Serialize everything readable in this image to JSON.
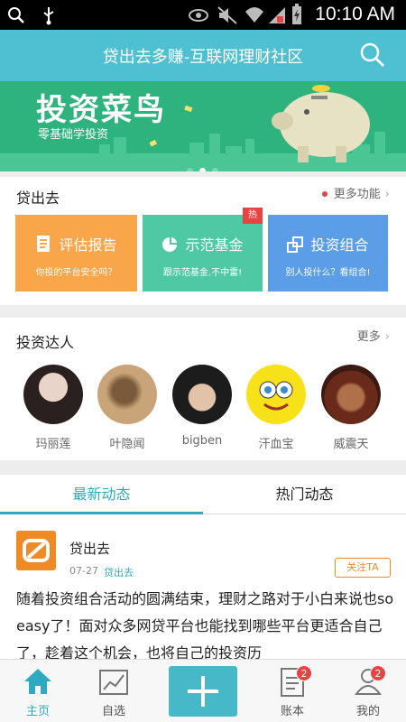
{
  "status_bar": {
    "time": "10:10 AM"
  },
  "header": {
    "title": "贷出去多赚-互联网理财社区"
  },
  "banner": {
    "title": "投资菜鸟",
    "subtitle": "零基础学投资"
  },
  "section1": {
    "title": "贷出去",
    "more": "更多功能",
    "cards": [
      {
        "title": "评估报告",
        "subtitle": "你投的平台安全吗？",
        "color": "#f9a54a"
      },
      {
        "title": "示范基金",
        "subtitle": "跟示范基金,不中雷!",
        "color": "#4ec9a4",
        "badge": "热"
      },
      {
        "title": "投资组合",
        "subtitle": "别人投什么？看组合!",
        "color": "#5b9de6"
      }
    ]
  },
  "section2": {
    "title": "投资达人",
    "more": "更多",
    "people": [
      {
        "name": "玛丽莲"
      },
      {
        "name": "叶隐闻"
      },
      {
        "name": "bigben"
      },
      {
        "name": "汗血宝"
      },
      {
        "name": "威震天"
      }
    ]
  },
  "tabs": [
    {
      "label": "最新动态"
    },
    {
      "label": "热门动态"
    }
  ],
  "feed": {
    "name": "贷出去",
    "date": "07-27",
    "source": "贷出去",
    "follow": "关注TA",
    "text": "随着投资组合活动的圆满结束，理财之路对于小白来说也so easy了！面对众多网贷平台也能找到哪些平台更适合自己了，趁着这个机会，也将自己的投资历"
  },
  "bottom_nav": [
    {
      "label": "主页",
      "icon": "home-icon"
    },
    {
      "label": "自选",
      "icon": "chart-icon"
    },
    {
      "label": "",
      "icon": "plus-icon"
    },
    {
      "label": "账本",
      "icon": "ledger-icon",
      "badge": "2"
    },
    {
      "label": "我的",
      "icon": "person-icon",
      "badge": "2"
    }
  ],
  "colors": {
    "accent": "#2eaac0",
    "header": "#4fc0d2",
    "banner": "#2eb37f"
  }
}
